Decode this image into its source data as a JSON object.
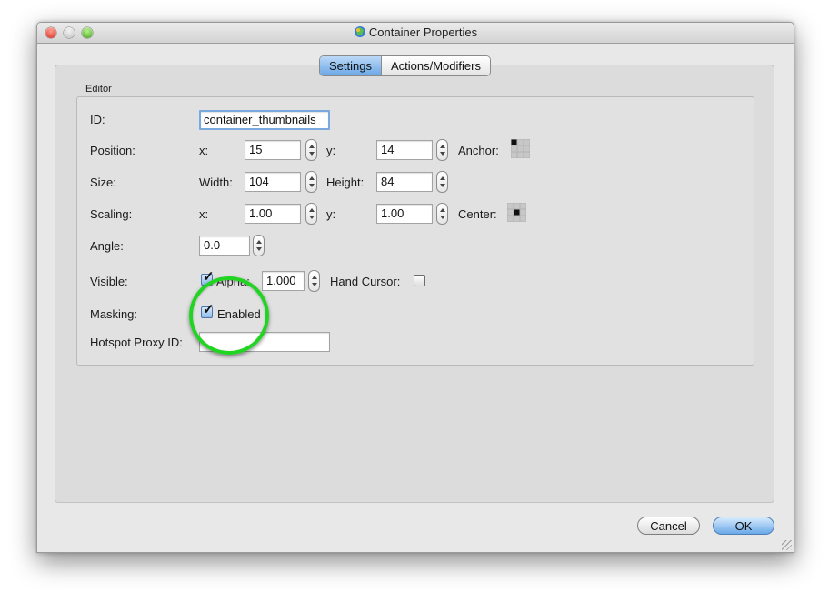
{
  "window": {
    "title": "Container Properties"
  },
  "tabs": [
    {
      "label": "Settings",
      "active": true
    },
    {
      "label": "Actions/Modifiers",
      "active": false
    }
  ],
  "editor": {
    "group_label": "Editor",
    "id": {
      "label": "ID:",
      "value": "container_thumbnails"
    },
    "position": {
      "label": "Position:",
      "x_label": "x:",
      "x": "15",
      "y_label": "y:",
      "y": "14",
      "anchor_label": "Anchor:",
      "anchor_selected": "top-left"
    },
    "size": {
      "label": "Size:",
      "width_label": "Width:",
      "width": "104",
      "height_label": "Height:",
      "height": "84"
    },
    "scaling": {
      "label": "Scaling:",
      "x_label": "x:",
      "x": "1.00",
      "y_label": "y:",
      "y": "1.00",
      "center_label": "Center:",
      "center_selected": "center"
    },
    "angle": {
      "label": "Angle:",
      "value": "0.0"
    },
    "visible": {
      "label": "Visible:",
      "checked": true,
      "alpha_label": "Alpha:",
      "alpha": "1.000",
      "hand_cursor_label": "Hand Cursor:",
      "hand_cursor_checked": false
    },
    "masking": {
      "label": "Masking:",
      "enabled_label": "Enabled",
      "checked": true
    },
    "hotspot": {
      "label": "Hotspot Proxy ID:",
      "value": ""
    }
  },
  "buttons": {
    "cancel": "Cancel",
    "ok": "OK"
  },
  "colors": {
    "highlight": "#22d422",
    "default_button": "#6aa8e8",
    "active_tab": "#6aa7e5"
  }
}
